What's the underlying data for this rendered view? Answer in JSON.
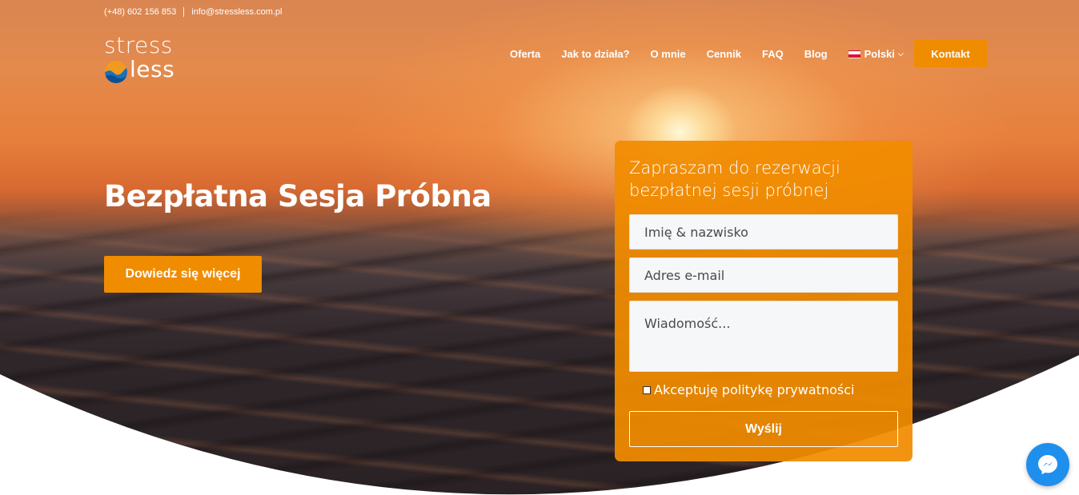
{
  "topbar": {
    "phone": "(+48) 602 156 853",
    "email": "info@stressless.com.pl"
  },
  "logo": {
    "line1": "stress",
    "line2": "less"
  },
  "nav": {
    "items": [
      "Oferta",
      "Jak to działa?",
      "O mnie",
      "Cennik",
      "FAQ",
      "Blog"
    ],
    "language": "Polski",
    "contact_button": "Kontakt"
  },
  "hero": {
    "title": "Bezpłatna Sesja Próbna",
    "cta_label": "Dowiedz się więcej"
  },
  "form": {
    "title": "Zapraszam do rezerwacji bezpłatnej sesji próbnej",
    "name_placeholder": "Imię & nazwisko",
    "email_placeholder": "Adres e-mail",
    "message_placeholder": "Wiadomość...",
    "consent_label": "Akceptuję politykę prywatności",
    "consent_checked": false,
    "submit_label": "Wyślij"
  },
  "colors": {
    "accent": "#f08c00",
    "messenger": "#1f8fee"
  },
  "icons": {
    "flag": "poland-flag-icon",
    "dropdown": "chevron-down-icon",
    "chat": "messenger-icon"
  }
}
